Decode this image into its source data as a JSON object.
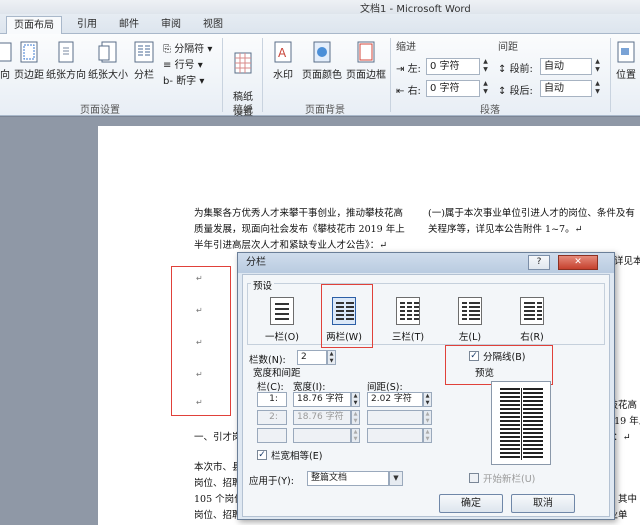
{
  "window": {
    "title": "文档1 - Microsoft Word"
  },
  "tabs": [
    {
      "label": "页面布局",
      "active": true
    },
    {
      "label": "引用",
      "active": false
    },
    {
      "label": "邮件",
      "active": false
    },
    {
      "label": "审阅",
      "active": false
    },
    {
      "label": "视图",
      "active": false
    }
  ],
  "ribbon": {
    "page_setup": {
      "label": "页面设置",
      "buttons": [
        "向",
        "页边距",
        "纸张方向",
        "纸张大小",
        "分栏"
      ],
      "small": [
        "分隔符 ▾",
        "行号 ▾",
        "断字 ▾"
      ]
    },
    "manuscript": {
      "label": "稿纸",
      "button": "稿纸\n设置"
    },
    "page_background": {
      "label": "页面背景",
      "buttons": [
        "水印",
        "页面颜色",
        "页面边框"
      ]
    },
    "paragraph": {
      "label": "段落",
      "indent_label": "缩进",
      "spacing_label": "间距",
      "left_label": "左:",
      "right_label": "右:",
      "before_label": "段前:",
      "after_label": "段后:",
      "left_value": "0 字符",
      "right_value": "0 字符",
      "before_value": "自动",
      "after_value": "自动"
    },
    "arrange": {
      "button": "位置"
    }
  },
  "document": {
    "left_col": [
      "为集聚各方优秀人才来攀干事创业，推动攀枝花高",
      "质量发展，现面向社会发布《攀枝花市 2019 年上",
      "半年引进高层次人才和紧缺专业人才公告》：↵"
    ],
    "right_col": [
      "(一)属于本次事业单位引进人才的岗位、条件及有",
      "关程序等，详见本公告附件 1~7。↵"
    ],
    "right_lines": [
      "条件等，详见本",
      "推动攀枝花高",
      "花市 2019 年上",
      "才公告》：↵",
      "条岗位，其中",
      "岗位、招聘",
      "市属事业单"
    ],
    "section_heading": "一、引才岗",
    "body_lines": [
      "本次市、县",
      "岗位、招聘",
      "105 个岗位",
      "岗位、招聘"
    ],
    "paragraph_mark": "↵"
  },
  "dialog": {
    "title": "分栏",
    "help": "?",
    "close": "✕",
    "presets_label": "预设",
    "presets": [
      "一栏(O)",
      "两栏(W)",
      "三栏(T)",
      "左(L)",
      "右(R)"
    ],
    "num_columns_label": "栏数(N):",
    "num_columns_value": "2",
    "line_between_label": "分隔线(B)",
    "line_between_checked": true,
    "preview_label": "预览",
    "width_spacing_label": "宽度和间距",
    "col_header": "栏(C):",
    "width_header": "宽度(I):",
    "spacing_header": "间距(S):",
    "rows": [
      {
        "col": "1:",
        "width": "18.76 字符",
        "spacing": "2.02 字符"
      },
      {
        "col": "2:",
        "width": "18.76 字符",
        "spacing": ""
      },
      {
        "col": "",
        "width": "",
        "spacing": ""
      }
    ],
    "equal_width_label": "栏宽相等(E)",
    "equal_width_checked": true,
    "apply_to_label": "应用于(Y):",
    "apply_to_value": "整篇文档",
    "start_new_label": "开始新栏(U)",
    "ok": "确定",
    "cancel": "取消"
  },
  "watermark": "Baidu 经验"
}
